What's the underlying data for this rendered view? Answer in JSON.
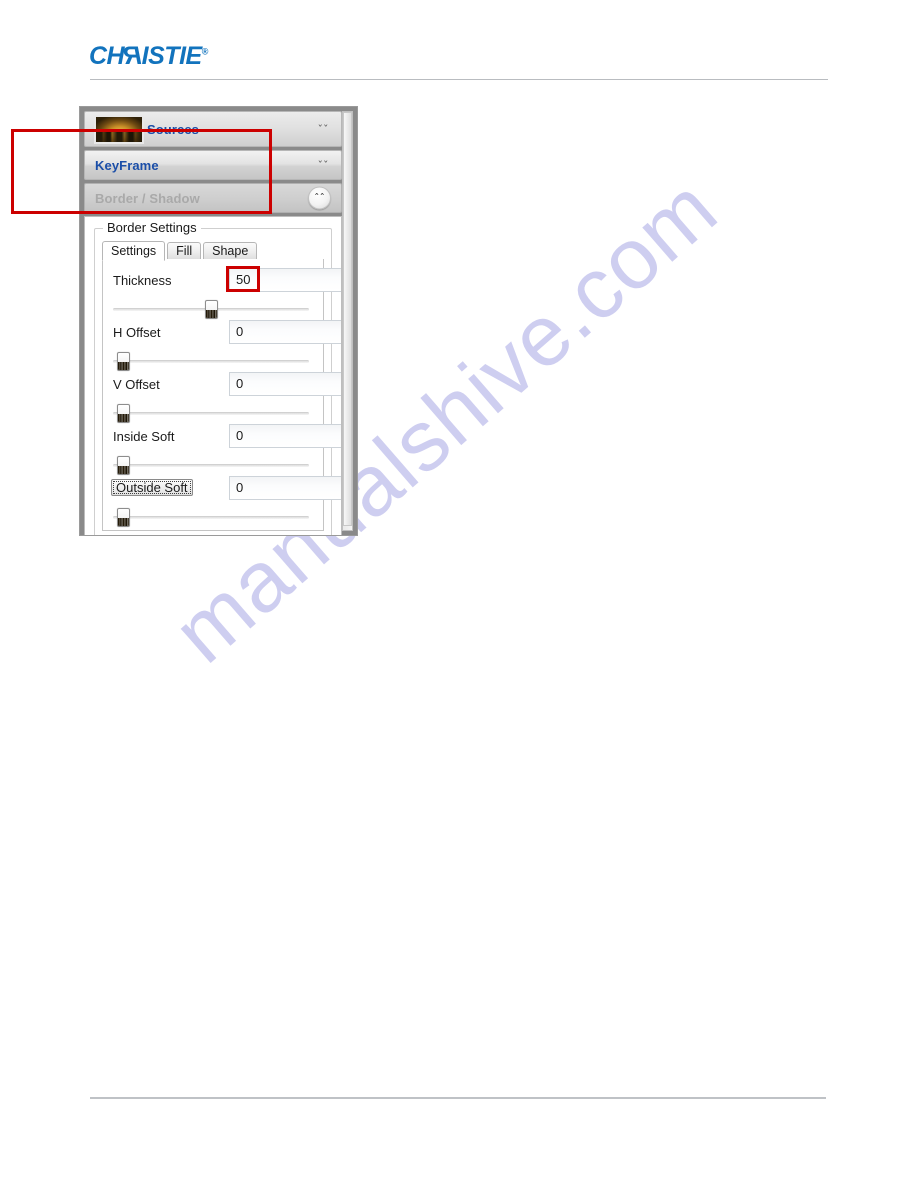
{
  "page": {
    "brand": "CHRISTIE",
    "brand_prefix": "CH",
    "brand_r": "R",
    "brand_suffix": "ISTIE",
    "brand_tm": "®",
    "watermark": "manualshive.com"
  },
  "panel": {
    "accordion": [
      {
        "label": "Sources",
        "icon": "thumbnail-sunset",
        "chevron": "chevron-double-down",
        "state": "collapsed",
        "disabled": false
      },
      {
        "label": "KeyFrame",
        "chevron": "chevron-double-down",
        "state": "collapsed",
        "disabled": false
      },
      {
        "label": "Border / Shadow",
        "chevron": "chevron-double-up",
        "state": "expanded",
        "disabled": true
      }
    ],
    "groupbox_label": "Border Settings",
    "tabs": [
      {
        "label": "Settings",
        "active": true
      },
      {
        "label": "Fill",
        "active": false
      },
      {
        "label": "Shape",
        "active": false
      }
    ],
    "rows": [
      {
        "label": "Thickness",
        "value": "50",
        "slider_percent": 50,
        "highlighted": true,
        "label_focus": false
      },
      {
        "label": "H Offset",
        "value": "0",
        "slider_percent": 2,
        "highlighted": false,
        "label_focus": false
      },
      {
        "label": "V Offset",
        "value": "0",
        "slider_percent": 2,
        "highlighted": false,
        "label_focus": false
      },
      {
        "label": "Inside Soft",
        "value": "0",
        "slider_percent": 2,
        "highlighted": false,
        "label_focus": false
      },
      {
        "label": "Outside Soft",
        "value": "0",
        "slider_percent": 2,
        "highlighted": false,
        "label_focus": true
      }
    ],
    "spinner_up": "▲",
    "spinner_down": "▼",
    "chevron_down_glyph": "ˇ",
    "chevron_up_glyph": "ˆ"
  },
  "colors": {
    "brand_blue": "#1273bd",
    "accordion_title_blue": "#1b4ea8",
    "annotation_red": "#cc0000",
    "watermark_purple": "#ccccf0",
    "panel_gray": "#8a8a8a"
  }
}
